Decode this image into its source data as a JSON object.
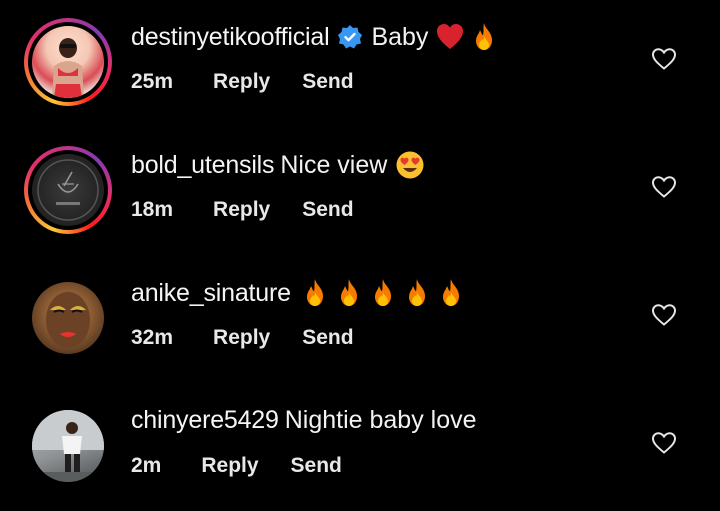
{
  "comments": [
    {
      "username": "destinyetikoofficial",
      "verified": true,
      "text": "Baby",
      "emojis": [
        "red-heart",
        "fire"
      ],
      "time": "25m",
      "reply_label": "Reply",
      "send_label": "Send",
      "has_story_ring": true
    },
    {
      "username": "bold_utensils",
      "verified": false,
      "text": "Nice view",
      "emojis": [
        "heart-eyes"
      ],
      "time": "18m",
      "reply_label": "Reply",
      "send_label": "Send",
      "has_story_ring": true
    },
    {
      "username": "anike_sinature",
      "verified": false,
      "text": "",
      "emojis": [
        "fire",
        "fire",
        "fire",
        "fire",
        "fire"
      ],
      "time": "32m",
      "reply_label": "Reply",
      "send_label": "Send",
      "has_story_ring": false
    },
    {
      "username": "chinyere5429",
      "verified": false,
      "text": "Nightie baby love",
      "emojis": [],
      "time": "2m",
      "reply_label": "Reply",
      "send_label": "Send",
      "has_story_ring": false
    }
  ],
  "colors": {
    "background": "#000000",
    "text": "#f5f5f5",
    "verified_blue": "#3897f0",
    "heart_outline": "#e6e6e6"
  },
  "icons": {
    "verified": "verified-badge-icon",
    "like": "heart-outline-icon"
  }
}
